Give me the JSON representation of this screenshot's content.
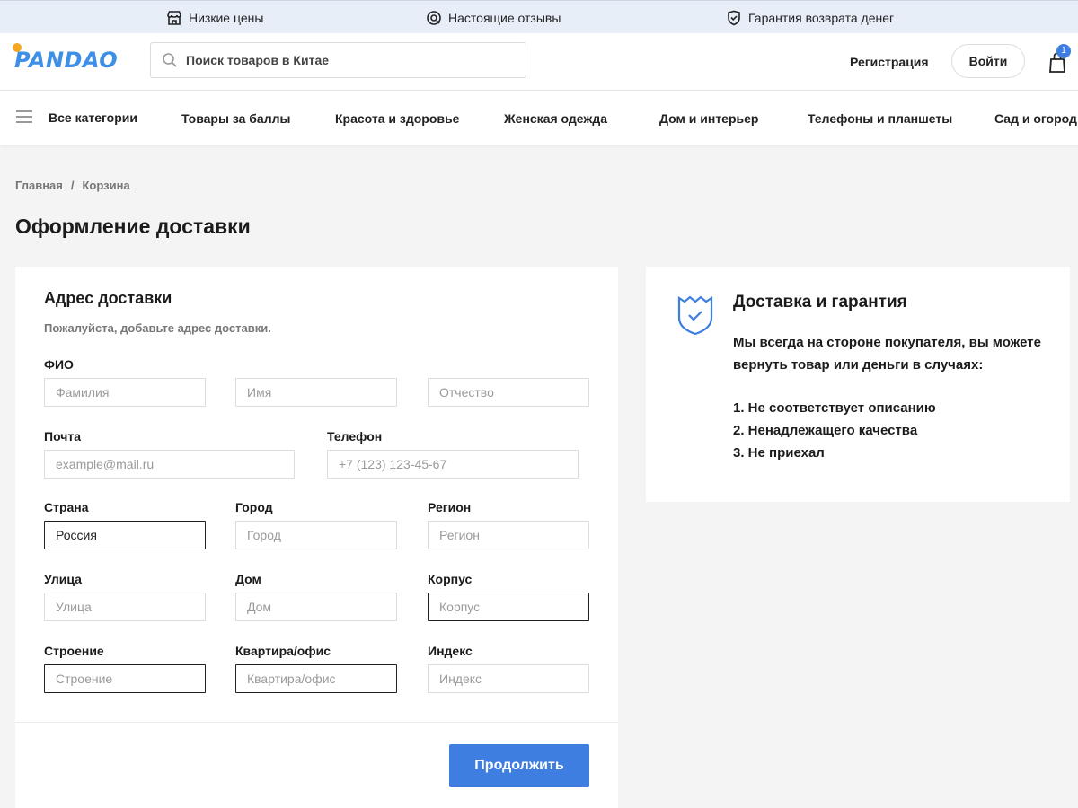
{
  "promo": {
    "items": [
      {
        "label": "Низкие цены",
        "icon": "store-icon"
      },
      {
        "label": "Настоящие отзывы",
        "icon": "reviews-icon"
      },
      {
        "label": "Гарантия возврата денег",
        "icon": "shield-check-icon"
      }
    ]
  },
  "header": {
    "logo_text": "PANDAO",
    "search_placeholder": "Поиск товаров в Китае",
    "register_label": "Регистрация",
    "login_label": "Войти",
    "cart_count": "1"
  },
  "nav": {
    "all_categories": "Все категории",
    "items": [
      "Товары за баллы",
      "Красота и здоровье",
      "Женская одежда",
      "Дом и интерьер",
      "Телефоны и планшеты",
      "Сад и огород"
    ]
  },
  "breadcrumb": {
    "home": "Главная",
    "separator": "/",
    "current": "Корзина"
  },
  "page_title": "Оформление доставки",
  "form": {
    "title": "Адрес доставки",
    "subtitle": "Пожалуйста, добавьте адрес доставки.",
    "fio_label": "ФИО",
    "lastname_placeholder": "Фамилия",
    "firstname_placeholder": "Имя",
    "patronymic_placeholder": "Отчество",
    "email_label": "Почта",
    "email_placeholder": "example@mail.ru",
    "phone_label": "Телефон",
    "phone_placeholder": "+7 (123) 123-45-67",
    "country_label": "Страна",
    "country_value": "Россия",
    "city_label": "Город",
    "city_placeholder": "Город",
    "region_label": "Регион",
    "region_placeholder": "Регион",
    "street_label": "Улица",
    "street_placeholder": "Улица",
    "house_label": "Дом",
    "house_placeholder": "Дом",
    "korpus_label": "Корпус",
    "korpus_placeholder": "Корпус",
    "building_label": "Строение",
    "building_placeholder": "Строение",
    "apartment_label": "Квартира/офис",
    "apartment_placeholder": "Квартира/офис",
    "index_label": "Индекс",
    "index_placeholder": "Индекс",
    "continue_label": "Продолжить"
  },
  "info": {
    "title": "Доставка и гарантия",
    "text": "Мы всегда на стороне покупателя, вы можете вернуть товар или деньги в случаях:",
    "items": [
      "1. Не соответствует описанию",
      "2. Ненадлежащего качества",
      "3. Не приехал"
    ]
  },
  "colors": {
    "accent": "#3e7ee0",
    "promo_bg": "#e8eef8",
    "page_bg": "#f4f4f4"
  }
}
